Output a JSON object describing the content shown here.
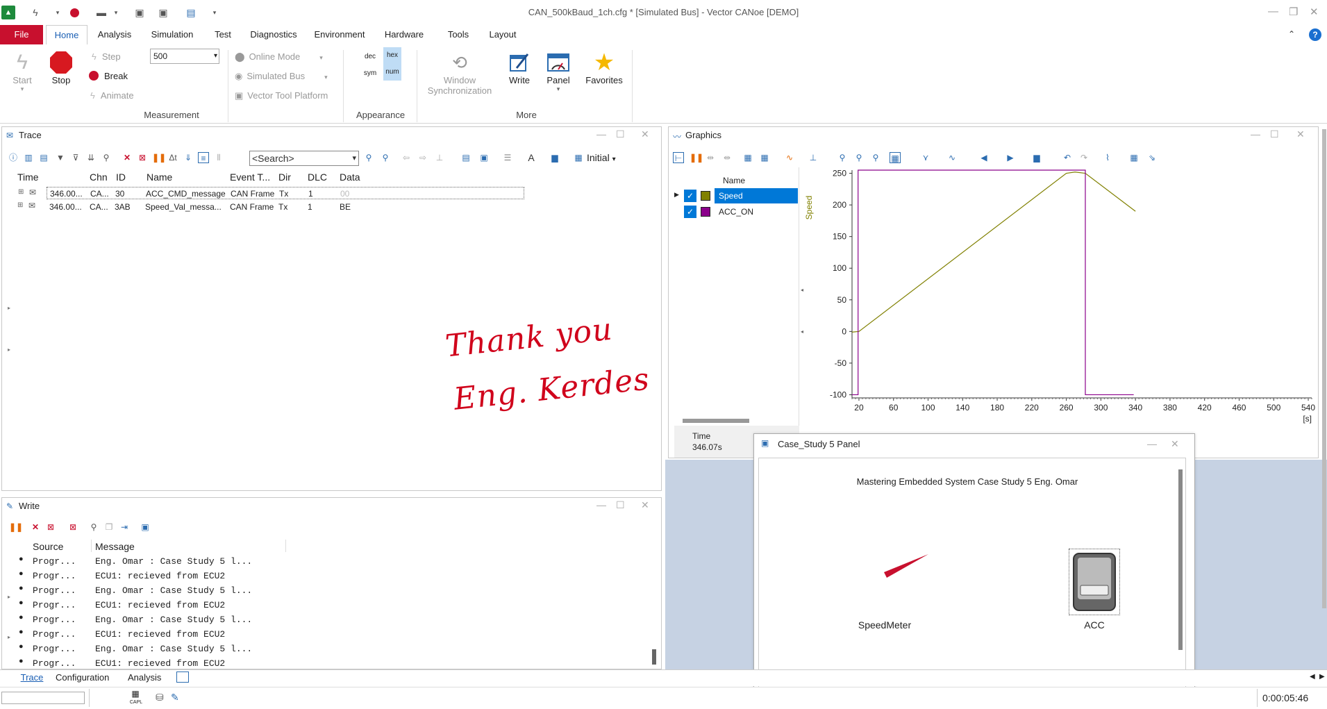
{
  "window": {
    "title": "CAN_500kBaud_1ch.cfg * [Simulated Bus] - Vector CANoe [DEMO]"
  },
  "tabs": [
    "File",
    "Home",
    "Analysis",
    "Simulation",
    "Test",
    "Diagnostics",
    "Environment",
    "Hardware",
    "Tools",
    "Layout"
  ],
  "ribbon": {
    "start": "Start",
    "stop": "Stop",
    "step": "Step",
    "break": "Break",
    "animate": "Animate",
    "step_value": "500",
    "measurement": "Measurement",
    "online_mode": "Online Mode",
    "simulated_bus": "Simulated Bus",
    "vector_tool_platform": "Vector Tool Platform",
    "dec": "dec",
    "hex": "hex",
    "sym": "sym",
    "num": "num",
    "appearance": "Appearance",
    "window_sync_1": "Window",
    "window_sync_2": "Synchronization",
    "write": "Write",
    "panel": "Panel",
    "favorites": "Favorites",
    "more": "More"
  },
  "trace": {
    "title": "Trace",
    "search_placeholder": "<Search>",
    "initial": "Initial",
    "columns": [
      "Time",
      "Chn",
      "ID",
      "Name",
      "Event T...",
      "Dir",
      "DLC",
      "Data"
    ],
    "rows": [
      {
        "time": "346.00...",
        "chn": "CA...",
        "id": "30",
        "name": "ACC_CMD_message",
        "event": "CAN Frame",
        "dir": "Tx",
        "dlc": "1",
        "data": "00"
      },
      {
        "time": "346.00...",
        "chn": "CA...",
        "id": "3AB",
        "name": "Speed_Val_messa...",
        "event": "CAN Frame",
        "dir": "Tx",
        "dlc": "1",
        "data": "BE"
      }
    ],
    "handwriting_1": "Thank you",
    "handwriting_2": "Eng. Kerdes"
  },
  "graphics": {
    "title": "Graphics",
    "col_name": "Name",
    "ylabel": "Speed",
    "signals": [
      {
        "name": "Speed",
        "color": "#808000"
      },
      {
        "name": "ACC_ON",
        "color": "#8b008b"
      }
    ],
    "time_label": "Time",
    "time_value": "346.07s",
    "unit": "[s]"
  },
  "chart_data": {
    "type": "line",
    "xlabel": "[s]",
    "ylabel": "Speed",
    "xlim": [
      12,
      544
    ],
    "ylim": [
      -105,
      255
    ],
    "xticks": [
      20,
      60,
      100,
      140,
      180,
      220,
      260,
      300,
      340,
      380,
      420,
      460,
      500,
      540
    ],
    "yticks": [
      250,
      200,
      150,
      100,
      50,
      0,
      -50,
      -100
    ],
    "series": [
      {
        "name": "Speed",
        "color": "#808000",
        "x": [
          12,
          20,
          260,
          270,
          282,
          340
        ],
        "y": [
          -1,
          0,
          250,
          252,
          250,
          190
        ]
      },
      {
        "name": "ACC_ON",
        "color": "#8b008b",
        "x": [
          12,
          19,
          19,
          282,
          282,
          338
        ],
        "y": [
          -100,
          -100,
          255,
          255,
          -100,
          -100
        ]
      }
    ]
  },
  "write": {
    "title": "Write",
    "col_source": "Source",
    "col_message": "Message",
    "rows": [
      {
        "source": "Progr...",
        "message": "Eng. Omar : Case Study 5 l..."
      },
      {
        "source": "Progr...",
        "message": "ECU1: recieved from ECU2"
      },
      {
        "source": "Progr...",
        "message": "Eng. Omar : Case Study 5 l..."
      },
      {
        "source": "Progr...",
        "message": "ECU1: recieved from ECU2"
      },
      {
        "source": "Progr...",
        "message": "Eng. Omar : Case Study 5 l..."
      },
      {
        "source": "Progr...",
        "message": "ECU1: recieved from ECU2"
      },
      {
        "source": "Progr...",
        "message": "Eng. Omar : Case Study 5 l..."
      },
      {
        "source": "Progr...",
        "message": "ECU1: recieved from ECU2"
      }
    ]
  },
  "panel": {
    "title": "Case_Study 5 Panel",
    "heading": "Mastering Embedded System Case Study 5 Eng. Omar",
    "speedmeter": "SpeedMeter",
    "acc": "ACC"
  },
  "bottom_tabs": [
    "Trace",
    "Configuration",
    "Analysis"
  ],
  "status": {
    "elapsed": "0:00:05:46",
    "capl": "CAPL"
  }
}
